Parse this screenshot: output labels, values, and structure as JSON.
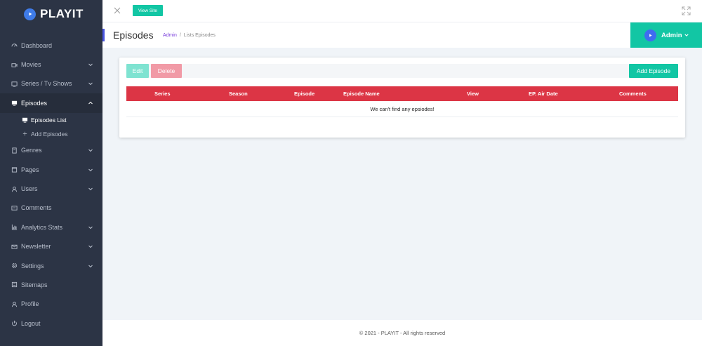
{
  "brand": {
    "name": "PLAYIT",
    "accent": "#3f7be8"
  },
  "colors": {
    "sidebar_bg": "#2c3445",
    "teal": "#12c6a4",
    "table_header": "#dc3545",
    "edit": "#7fe3d1",
    "delete": "#f19aa6"
  },
  "topbar": {
    "view_site_label": "View Site"
  },
  "header": {
    "title": "Episodes",
    "breadcrumb": {
      "root": "Admin",
      "separator": "/",
      "current": "Lists Episodes"
    },
    "user": {
      "name": "Admin"
    }
  },
  "sidebar": {
    "items": [
      {
        "label": "Dashboard",
        "icon": "dashboard-icon",
        "has_children": false
      },
      {
        "label": "Movies",
        "icon": "movie-icon",
        "has_children": true
      },
      {
        "label": "Series / Tv Shows",
        "icon": "tv-icon",
        "has_children": true
      },
      {
        "label": "Episodes",
        "icon": "episodes-icon",
        "has_children": true,
        "expanded": true,
        "children": [
          {
            "label": "Episodes List",
            "icon": "list-icon",
            "active": true
          },
          {
            "label": "Add Episodes",
            "icon": "plus-icon",
            "active": false
          }
        ]
      },
      {
        "label": "Genres",
        "icon": "genre-icon",
        "has_children": true
      },
      {
        "label": "Pages",
        "icon": "pages-icon",
        "has_children": true
      },
      {
        "label": "Users",
        "icon": "user-icon",
        "has_children": true
      },
      {
        "label": "Comments",
        "icon": "comments-icon",
        "has_children": false
      },
      {
        "label": "Analytics Stats",
        "icon": "analytics-icon",
        "has_children": true
      },
      {
        "label": "Newsletter",
        "icon": "mail-icon",
        "has_children": true
      },
      {
        "label": "Settings",
        "icon": "settings-icon",
        "has_children": true
      },
      {
        "label": "Sitemaps",
        "icon": "sitemap-icon",
        "has_children": false
      },
      {
        "label": "Profile",
        "icon": "profile-icon",
        "has_children": false
      },
      {
        "label": "Logout",
        "icon": "logout-icon",
        "has_children": false
      }
    ]
  },
  "toolbar": {
    "edit_label": "Edit",
    "delete_label": "Delete",
    "add_label": "Add Episode"
  },
  "table": {
    "columns": [
      "Series",
      "Season",
      "Episode",
      "Episode Name",
      "View",
      "EP. Air Date",
      "Comments"
    ],
    "empty_message": "We can't find any epsiodes!"
  },
  "footer": {
    "text": "© 2021 - PLAYIT - All rights reserved"
  }
}
